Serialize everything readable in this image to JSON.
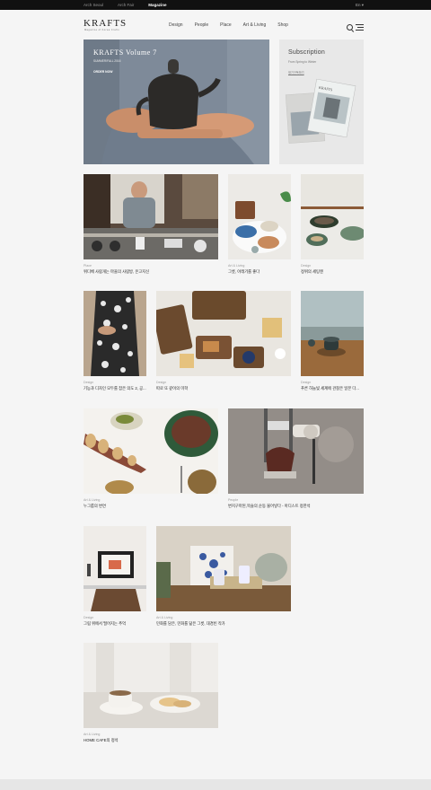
{
  "topbar": {
    "links": [
      "Arch Seoul",
      "Arch Fair",
      "Magazine"
    ],
    "lang": "En"
  },
  "header": {
    "logo": "KRAFTS",
    "logo_sub": "Magazine of Korea Crafts",
    "nav": [
      "Design",
      "People",
      "Place",
      "Art & Living",
      "Shop"
    ]
  },
  "hero": {
    "title": "KRAFTS Volume 7",
    "subtitle": "SUMMER/FALL 2016",
    "cta": "ORDER NOW"
  },
  "subscription": {
    "title": "Subscription",
    "subtitle": "From Spring to Winter",
    "link": "정기구독하기"
  },
  "cards": [
    {
      "category": "Place",
      "title": "위디베 사람개는 마을의 사람방, 온고지신"
    },
    {
      "category": "Art & Living",
      "title": "그릇, 아래기를 좋다"
    },
    {
      "category": "Design",
      "title": "정위의 세팅엔"
    },
    {
      "category": "Design",
      "title": "기능과 디자인 모두를 잡은 의도 2, 공..."
    },
    {
      "category": "Design",
      "title": "따로 또 같이의 미학"
    },
    {
      "category": "Design",
      "title": "푸른 하늘빛 세계에 관찰은 일본 다..."
    },
    {
      "category": "Art & Living",
      "title": "누그룹의 변연"
    },
    {
      "category": "People",
      "title": "변지구마된,목슬의 순동 불어넣다 - 아디스트 정한석"
    },
    {
      "category": "Design",
      "title": "그림 위에서 떨어지는 추억"
    },
    {
      "category": "Art & Living",
      "title": "민화를 담은, 민화를 닮은 그릇, 대경빈 작가"
    },
    {
      "category": "Art & Living",
      "title": "HOME CAFE의 정석"
    }
  ],
  "colors": {
    "topbar": "#111111",
    "background": "#f5f5f5",
    "footer": "#e6e6e6"
  }
}
